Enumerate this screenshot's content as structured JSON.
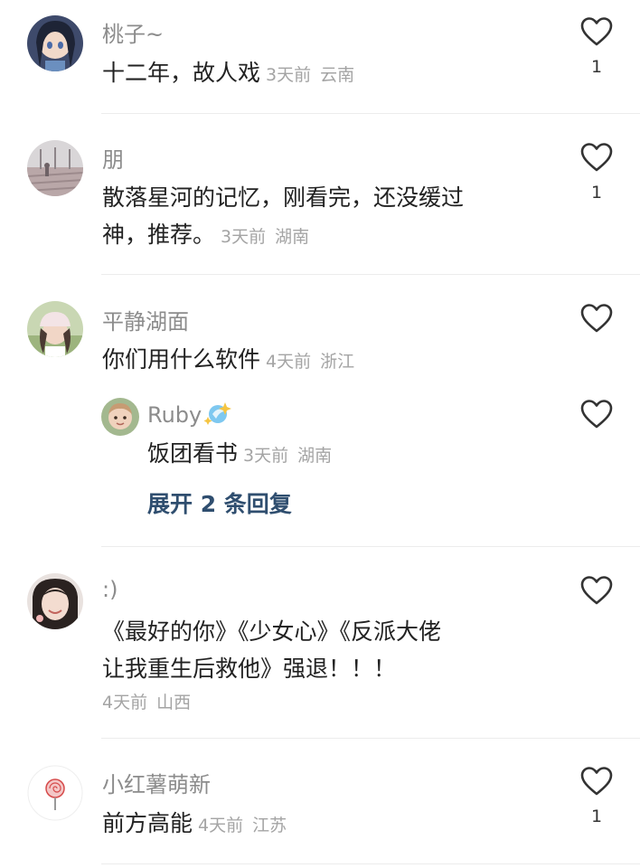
{
  "comments": [
    {
      "username": "桃子~",
      "text": "十二年，故人戏",
      "time": "3天前",
      "location": "云南",
      "likes": "1",
      "avatar": "anime-girl-avatar"
    },
    {
      "username": "朋",
      "text_line1": "散落星河的记忆，刚看完，还没缓过",
      "text_line2": "神，推荐。",
      "time": "3天前",
      "location": "湖南",
      "likes": "1",
      "avatar": "wooden-pier-avatar"
    },
    {
      "username": "平静湖面",
      "text": "你们用什么软件",
      "time": "4天前",
      "location": "浙江",
      "likes": "",
      "avatar": "woman-cap-avatar",
      "reply": {
        "username": "Ruby",
        "text": "饭团看书",
        "time": "3天前",
        "location": "湖南",
        "avatar": "baby-avatar"
      },
      "expand_label": "展开 2 条回复"
    },
    {
      "username": ":)",
      "text_line1": "《最好的你》《少女心》《反派大佬",
      "text_line2": "让我重生后救他》强退！！！",
      "time": "4天前",
      "location": "山西",
      "likes": "",
      "avatar": "smiling-girl-avatar"
    },
    {
      "username": "小红薯萌新",
      "text": "前方高能",
      "time": "4天前",
      "location": "江苏",
      "likes": "1",
      "avatar": "lollipop-avatar"
    }
  ],
  "colors": {
    "username": "#8c8c8c",
    "meta": "#a4a4a4",
    "expand_link": "#2f4e6f",
    "divider": "#ececec"
  }
}
